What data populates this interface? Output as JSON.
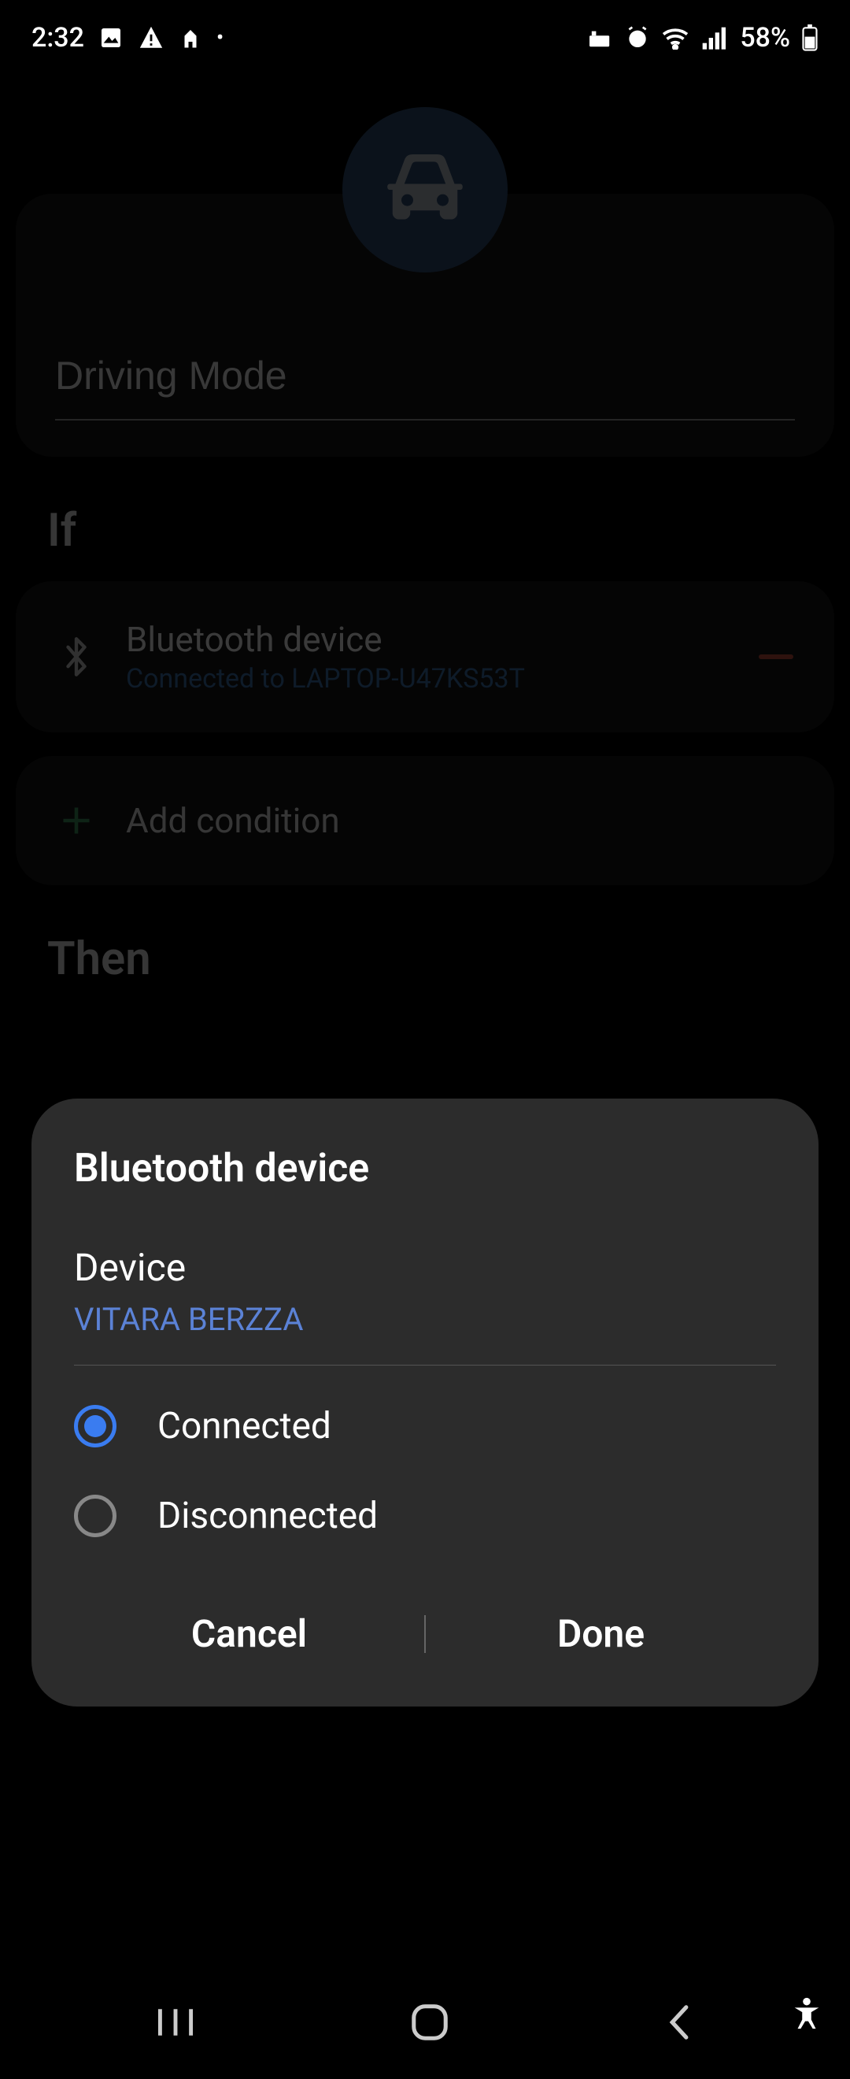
{
  "status": {
    "time": "2:32",
    "battery": "58%"
  },
  "background": {
    "name_value": "Driving Mode",
    "section_if": "If",
    "section_then": "Then",
    "condition": {
      "title": "Bluetooth device",
      "subtitle": "Connected to LAPTOP-U47KS53T"
    },
    "add_condition": "Add condition"
  },
  "dialog": {
    "title": "Bluetooth device",
    "device_label": "Device",
    "device_name": "VITARA BERZZA",
    "options": {
      "connected": "Connected",
      "disconnected": "Disconnected"
    },
    "cancel": "Cancel",
    "done": "Done"
  }
}
